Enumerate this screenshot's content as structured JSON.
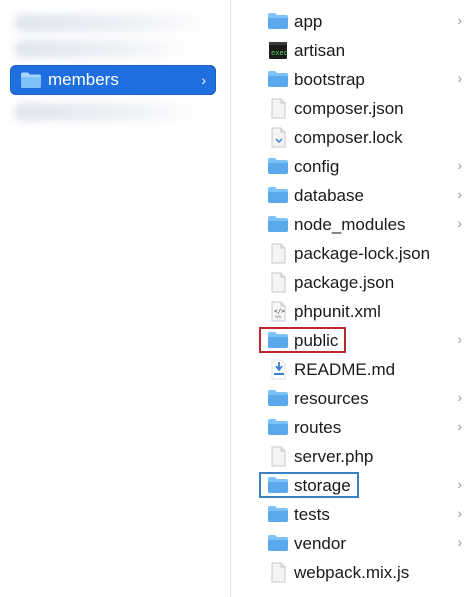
{
  "sidebar": {
    "selected_label": "members"
  },
  "files": [
    {
      "name": "app",
      "type": "folder"
    },
    {
      "name": "artisan",
      "type": "exec"
    },
    {
      "name": "bootstrap",
      "type": "folder"
    },
    {
      "name": "composer.json",
      "type": "file"
    },
    {
      "name": "composer.lock",
      "type": "lock"
    },
    {
      "name": "config",
      "type": "folder"
    },
    {
      "name": "database",
      "type": "folder"
    },
    {
      "name": "node_modules",
      "type": "folder"
    },
    {
      "name": "package-lock.json",
      "type": "file"
    },
    {
      "name": "package.json",
      "type": "file"
    },
    {
      "name": "phpunit.xml",
      "type": "xml"
    },
    {
      "name": "public",
      "type": "folder",
      "highlight": "#c0262d"
    },
    {
      "name": "README.md",
      "type": "md"
    },
    {
      "name": "resources",
      "type": "folder"
    },
    {
      "name": "routes",
      "type": "folder"
    },
    {
      "name": "server.php",
      "type": "file"
    },
    {
      "name": "storage",
      "type": "folder",
      "highlight": "#3b82c4"
    },
    {
      "name": "tests",
      "type": "folder"
    },
    {
      "name": "vendor",
      "type": "folder"
    },
    {
      "name": "webpack.mix.js",
      "type": "file"
    }
  ],
  "icons": {
    "folder": "folder-icon",
    "exec": "terminal-icon",
    "file": "document-icon",
    "lock": "lock-file-icon",
    "xml": "xml-file-icon",
    "md": "markdown-file-icon",
    "chevron": "chevron-right-icon"
  },
  "colors": {
    "selection": "#1f6fe0",
    "folder": "#5aa9ea",
    "highlight_red": "#c0262d",
    "highlight_blue": "#3b82c4"
  }
}
